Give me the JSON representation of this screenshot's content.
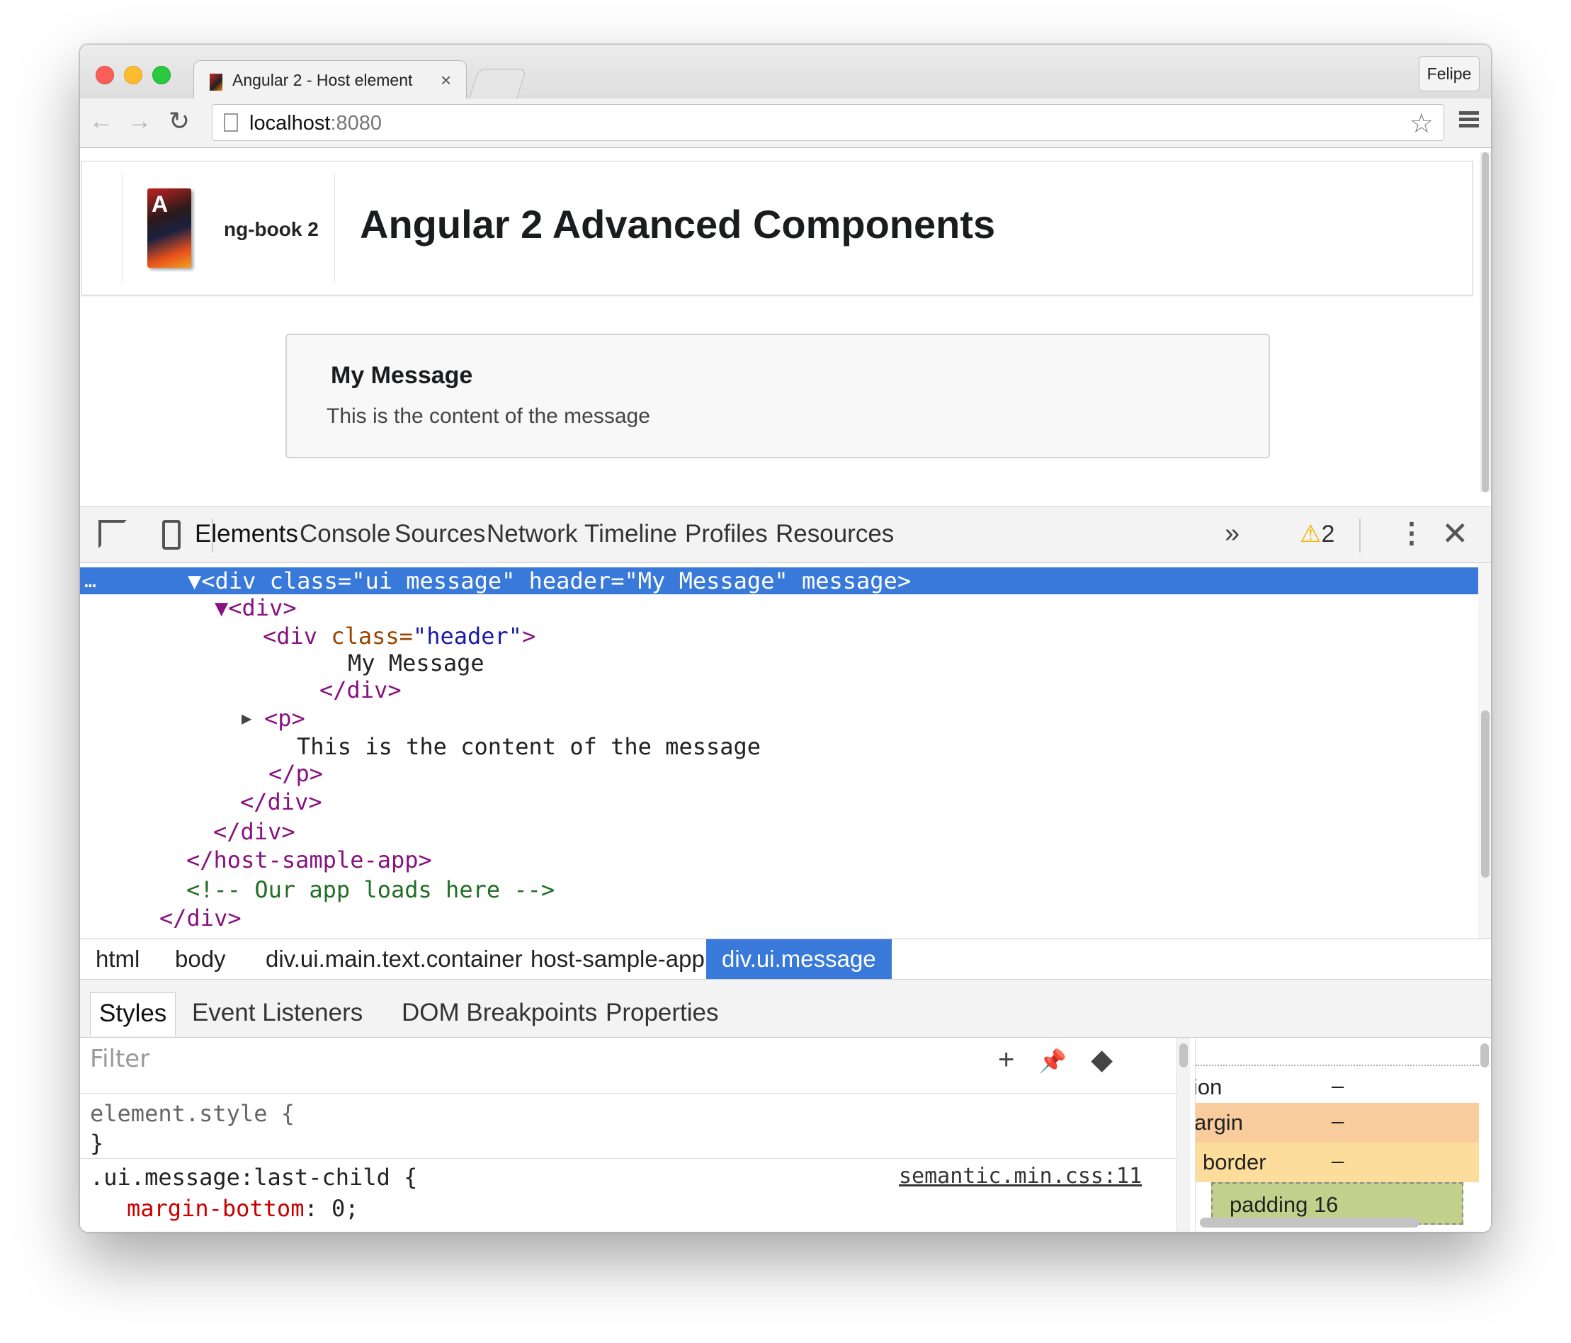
{
  "browser": {
    "tab_title": "Angular 2 - Host element",
    "tab_close": "×",
    "profile_name": "Felipe",
    "url_host": "localhost",
    "url_port": ":8080",
    "back_icon": "←",
    "forward_icon": "→",
    "reload_icon": "↻",
    "star_icon": "☆"
  },
  "page": {
    "brand_name": "ng-book 2",
    "book_letter": "A",
    "title": "Angular 2 Advanced Components",
    "message_header": "My Message",
    "message_content": "This is the content of the message"
  },
  "devtools": {
    "tabs": [
      "Elements",
      "Console",
      "Sources",
      "Network",
      "Timeline",
      "Profiles",
      "Resources"
    ],
    "more_tabs": "»",
    "warning_icon": "⚠",
    "warning_count": "2",
    "kebab": "⋮",
    "close": "✕",
    "tree": {
      "selected_ellipsis": "…",
      "sel_open": "▼<div ",
      "sel_attr_class": "class=",
      "sel_val_class": "\"ui message\"",
      "sel_attr_header": " header=",
      "sel_val_header": "\"My Message\"",
      "sel_attr_message": " message",
      "sel_close": ">",
      "row2_tag": "▼<div>",
      "row3_tag": "<div ",
      "row3_attr": "class=",
      "row3_val": "\"header\"",
      "row3_end": ">",
      "row4_text": "My Message",
      "row5_tag": "</div>",
      "row6_arrow": "▶",
      "row6_tag": "<p>",
      "row7_text": "This is the content of the message",
      "row8_tag": "</p>",
      "row9_tag": "</div>",
      "row10_tag": "</div>",
      "row11_tag": "</host-sample-app>",
      "row12_comment": "<!-- Our app loads here -->",
      "row13_tag": "</div>"
    },
    "breadcrumbs": [
      "html",
      "body",
      "div.ui.main.text.container",
      "host-sample-app",
      "div.ui.message"
    ],
    "sub_tabs": [
      "Styles",
      "Event Listeners",
      "DOM Breakpoints",
      "Properties"
    ],
    "styles": {
      "filter_placeholder": "Filter",
      "add_icon": "+",
      "pin_icon": "📌",
      "toggle_icon": "◆",
      "element_style_open": "element.style {",
      "element_style_close": "}",
      "rule_selector": ".ui.message:last-child {",
      "rule_prop": "margin-bottom",
      "rule_value": ": 0;",
      "rule_source": "semantic.min.css:11"
    },
    "box_model": {
      "position_label": "ion",
      "position_value": "–",
      "margin_label": "argin",
      "margin_value": "–",
      "border_label": "border",
      "border_value": "–",
      "padding_label": "padding 16"
    }
  }
}
